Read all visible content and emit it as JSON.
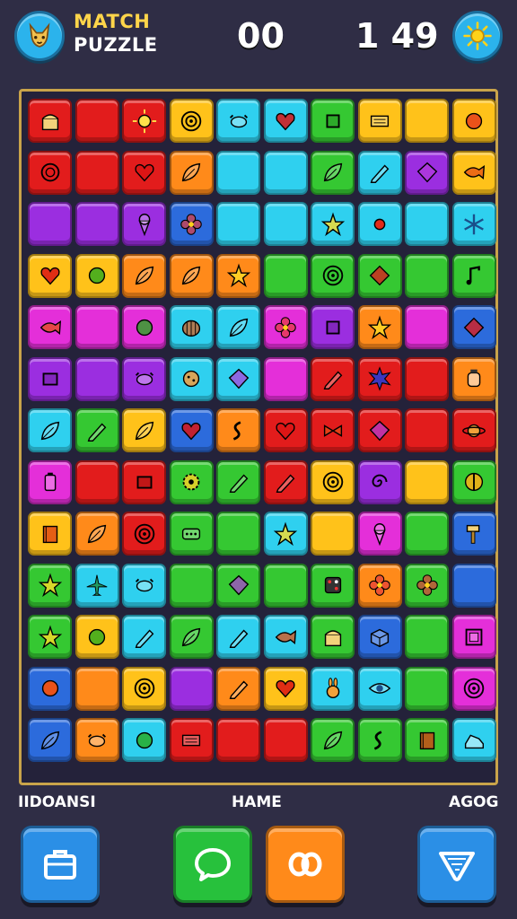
{
  "header": {
    "title_line1": "MATCH",
    "title_line2": "PUZZLE",
    "score_left": "00",
    "score_right": "1 49",
    "left_button_icon": "fox-face-icon",
    "right_button_icon": "sun-icon"
  },
  "board": {
    "rows": 14,
    "cols": 10,
    "tiles": [
      [
        "red:chest",
        "red:none",
        "red:sun",
        "yellow:target",
        "cyan:crab",
        "cyan:heart",
        "green:square",
        "yellow:scroll",
        "yellow:none",
        "yellow:orb"
      ],
      [
        "red:ring",
        "red:none",
        "red:heart",
        "orange:leaf",
        "cyan:none",
        "cyan:none",
        "green:leaf",
        "cyan:pencil",
        "purple:gem",
        "yellow:fish"
      ],
      [
        "purple:none",
        "purple:none",
        "purple:icecream",
        "blue:flower",
        "cyan:none",
        "cyan:none",
        "cyan:star",
        "cyan:dot",
        "cyan:none",
        "cyan:snowflake"
      ],
      [
        "yellow:heart",
        "yellow:circle",
        "orange:leaf",
        "orange:leaf",
        "orange:star",
        "green:none",
        "green:target",
        "green:diamond",
        "green:none",
        "green:note"
      ],
      [
        "pink:fish",
        "pink:none",
        "pink:circle",
        "cyan:shell",
        "cyan:leaf",
        "pink:flower",
        "purple:square",
        "orange:star",
        "pink:none",
        "blue:diamond"
      ],
      [
        "purple:rect",
        "purple:none",
        "purple:crab",
        "cyan:cookie",
        "cyan:gem",
        "pink:none",
        "red:pencil",
        "red:burst",
        "red:none",
        "orange:lantern"
      ],
      [
        "cyan:leaf",
        "green:pencil",
        "yellow:leaf",
        "blue:heart",
        "orange:squiggle",
        "red:heart",
        "red:bow",
        "red:gem",
        "red:none",
        "red:planet"
      ],
      [
        "pink:battery",
        "red:none",
        "red:rect",
        "green:gear",
        "green:pencil",
        "red:pencil",
        "yellow:target",
        "purple:swirl",
        "yellow:none",
        "green:ball"
      ],
      [
        "yellow:book",
        "orange:leaf",
        "red:target",
        "green:dots",
        "green:none",
        "cyan:star",
        "yellow:none",
        "pink:icecream",
        "green:none",
        "blue:hammer"
      ],
      [
        "green:star",
        "cyan:plane",
        "cyan:crab",
        "green:none",
        "green:gem",
        "green:none",
        "green:dice",
        "orange:flower",
        "green:flower",
        "blue:none"
      ],
      [
        "green:star",
        "yellow:circle",
        "cyan:pencil",
        "green:leaf",
        "cyan:pencil",
        "cyan:fish",
        "green:chest",
        "blue:box",
        "green:none",
        "pink:frame"
      ],
      [
        "blue:orb",
        "orange:none",
        "yellow:target",
        "purple:none",
        "orange:pencil",
        "yellow:heart",
        "cyan:rabbit",
        "cyan:eye",
        "green:none",
        "pink:target"
      ],
      [
        "blue:leaf",
        "orange:crab",
        "cyan:circle",
        "red:scroll",
        "red:none",
        "red:none",
        "green:leaf",
        "green:squiggle",
        "green:book",
        "cyan:shoe"
      ]
    ]
  },
  "footer": {
    "label_left": "IIDOANSI",
    "label_mid": "HAME",
    "label_right": "AGOG",
    "buttons": [
      {
        "name": "briefcase-icon"
      },
      {
        "name": "chat-bubble-icon"
      },
      {
        "name": "link-rings-icon"
      },
      {
        "name": "shield-icon"
      }
    ]
  },
  "colors": {
    "background": "#2f2d45",
    "board_border": "#c9a44a",
    "tile_red": "#e21c1c",
    "tile_yellow": "#ffc21a",
    "tile_cyan": "#2fd0ef",
    "tile_green": "#35c832",
    "tile_purple": "#9b2ee0",
    "tile_pink": "#e42fd9",
    "tile_orange": "#ff8a1a",
    "tile_blue": "#2c6bdc"
  }
}
